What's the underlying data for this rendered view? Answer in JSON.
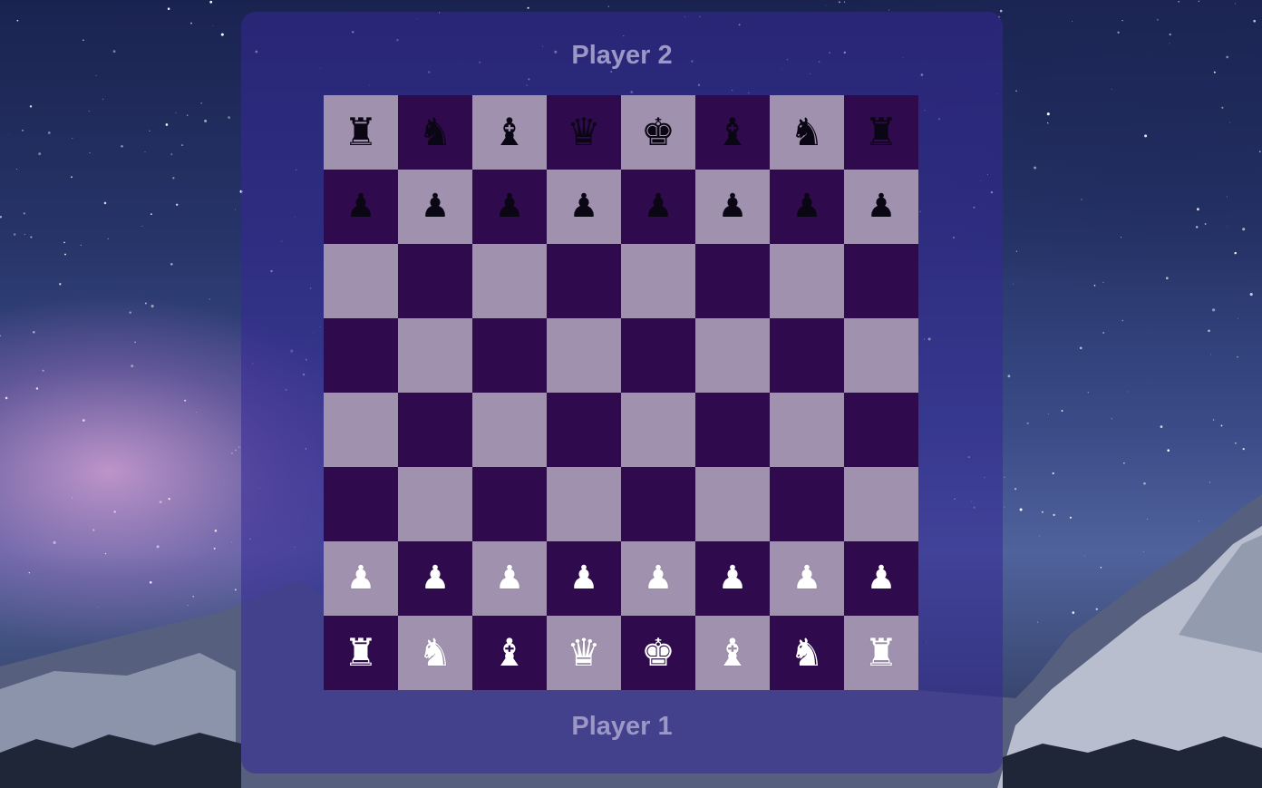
{
  "players": {
    "top": "Player 2",
    "bottom": "Player 1"
  },
  "colors": {
    "light_square": "#a092ae",
    "dark_square": "#2f0a4d",
    "panel": "#3428a0",
    "label": "#9b97c6"
  },
  "board": [
    [
      "b:rook-icon",
      "b:knight-icon",
      "b:bishop-icon",
      "b:queen-icon",
      "b:king-icon",
      "b:bishop-icon",
      "b:knight-icon",
      "b:rook-icon"
    ],
    [
      "b:pawn-icon",
      "b:pawn-icon",
      "b:pawn-icon",
      "b:pawn-icon",
      "b:pawn-icon",
      "b:pawn-icon",
      "b:pawn-icon",
      "b:pawn-icon"
    ],
    [
      "",
      "",
      "",
      "",
      "",
      "",
      "",
      ""
    ],
    [
      "",
      "",
      "",
      "",
      "",
      "",
      "",
      ""
    ],
    [
      "",
      "",
      "",
      "",
      "",
      "",
      "",
      ""
    ],
    [
      "",
      "",
      "",
      "",
      "",
      "",
      "",
      ""
    ],
    [
      "w:pawn-icon",
      "w:pawn-icon",
      "w:pawn-icon",
      "w:pawn-icon",
      "w:pawn-icon",
      "w:pawn-icon",
      "w:pawn-icon",
      "w:pawn-icon"
    ],
    [
      "w:rook-icon",
      "w:knight-icon",
      "w:bishop-icon",
      "w:queen-icon",
      "w:king-icon",
      "w:bishop-icon",
      "w:knight-icon",
      "w:rook-icon"
    ]
  ]
}
